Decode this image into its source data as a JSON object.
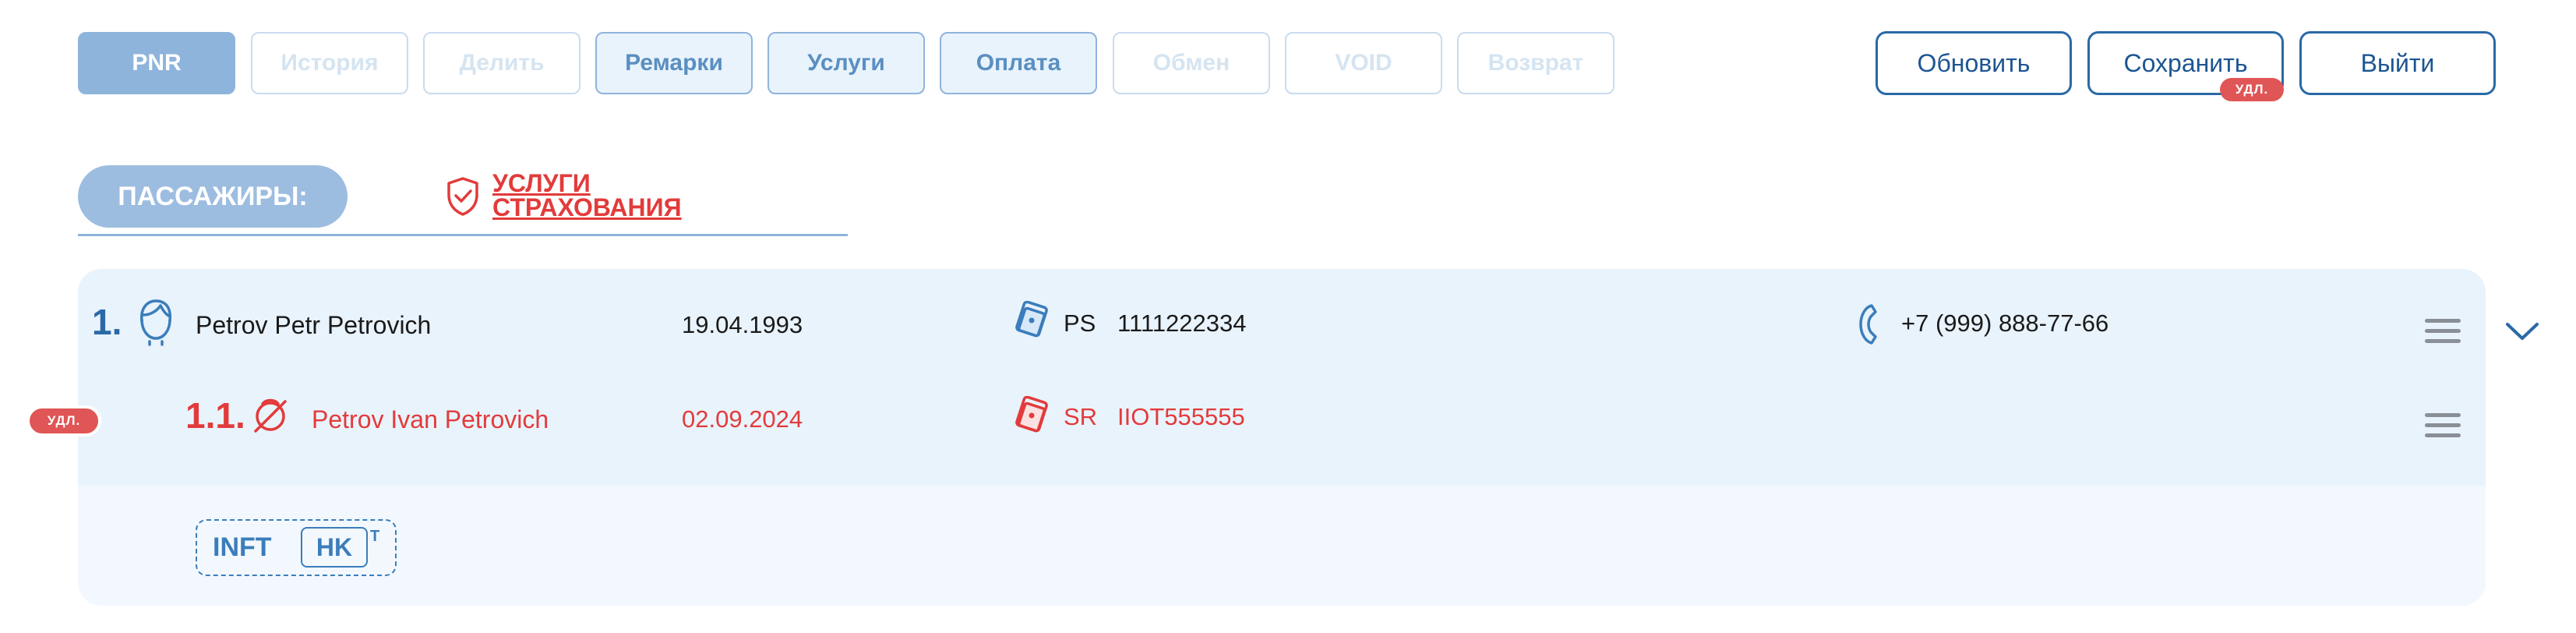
{
  "tabs": [
    {
      "label": "PNR",
      "state": "active"
    },
    {
      "label": "История",
      "state": "disabled"
    },
    {
      "label": "Делить",
      "state": "disabled"
    },
    {
      "label": "Ремарки",
      "state": "enabled"
    },
    {
      "label": "Услуги",
      "state": "enabled"
    },
    {
      "label": "Оплата",
      "state": "enabled"
    },
    {
      "label": "Обмен",
      "state": "disabled"
    },
    {
      "label": "VOID",
      "state": "disabled"
    },
    {
      "label": "Возврат",
      "state": "disabled"
    }
  ],
  "actions": {
    "refresh": "Обновить",
    "save": "Сохранить",
    "save_badge": "УДЛ.",
    "exit": "Выйти"
  },
  "passengers_header": "ПАССАЖИРЫ:",
  "insurance": {
    "line1": "УСЛУГИ",
    "line2": "СТРАХОВАНИЯ"
  },
  "passenger1": {
    "number": "1.",
    "name": "Petrov Petr Petrovich",
    "dob": "19.04.1993",
    "doc_type": "PS",
    "doc_number": "1111222334",
    "phone": "+7 (999) 888-77-66"
  },
  "passenger2": {
    "number": "1.1.",
    "badge": "УДЛ.",
    "name": "Petrov Ivan Petrovich",
    "dob": "02.09.2024",
    "doc_type": "SR",
    "doc_number": "IIOT555555"
  },
  "ssr": {
    "code": "INFT",
    "status": "HK",
    "sup": "T"
  },
  "colors": {
    "accent": "#2a69a6",
    "tab_active": "#8fb4dc",
    "danger": "#e23b3b",
    "panel": "#e9f3fc"
  }
}
